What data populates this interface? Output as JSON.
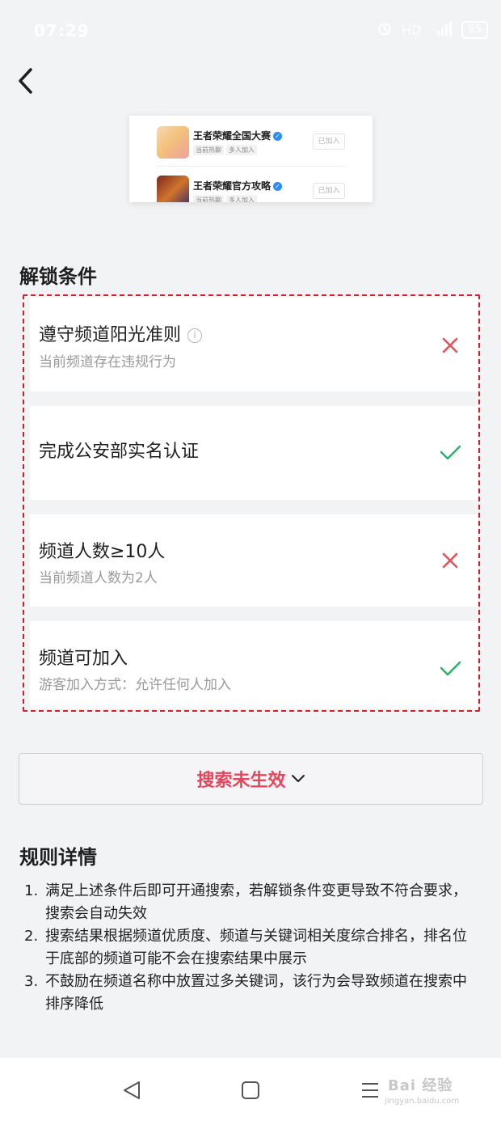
{
  "status_bar": {
    "time": "07:29",
    "hd": "HD",
    "signal": "4G",
    "battery": "95"
  },
  "preview": {
    "channels": [
      {
        "name": "王者荣耀全国大赛",
        "tags": [
          "当前热聊",
          "多人加入"
        ],
        "status": "已加入"
      },
      {
        "name": "王者荣耀官方攻略",
        "tags": [
          "当前热聊",
          "多人加入"
        ],
        "status": "已加入"
      }
    ]
  },
  "unlock": {
    "title": "解锁条件",
    "conditions": [
      {
        "title": "遵守频道阳光准则",
        "subtitle": "当前频道存在违规行为",
        "met": false
      },
      {
        "title": "完成公安部实名认证",
        "subtitle": "",
        "met": true
      },
      {
        "title": "频道人数≥10人",
        "subtitle": "当前频道人数为2人",
        "met": false
      },
      {
        "title": "频道可加入",
        "subtitle": "游客加入方式：允许任何人加入",
        "met": true
      }
    ]
  },
  "search_status": {
    "label": "搜索未生效"
  },
  "rules": {
    "title": "规则详情",
    "items": [
      {
        "num": "1.",
        "text": "满足上述条件后即可开通搜索，若解锁条件变更导致不符合要求，搜索会自动失效"
      },
      {
        "num": "2.",
        "text": "搜索结果根据频道优质度、频道与关键词相关度综合排名，排名位于底部的频道可能不会在搜索结果中展示"
      },
      {
        "num": "3.",
        "text": "不鼓励在频道名称中放置过多关键词，该行为会导致频道在搜索中排序降低"
      }
    ]
  },
  "watermark": {
    "brand": "Bai 经验",
    "url": "jingyan.baidu.com"
  },
  "colors": {
    "fail": "#e8505b",
    "pass": "#2bb36b",
    "accent": "#e6465c",
    "highlight_border": "#d61f26"
  },
  "icons": {
    "back": "chevron-left-icon",
    "info": "info-icon",
    "fail": "cross-icon",
    "pass": "check-icon",
    "expand": "chevron-down-icon",
    "nav_back": "triangle-back-icon",
    "nav_home": "square-home-icon",
    "nav_menu": "menu-lines-icon"
  }
}
